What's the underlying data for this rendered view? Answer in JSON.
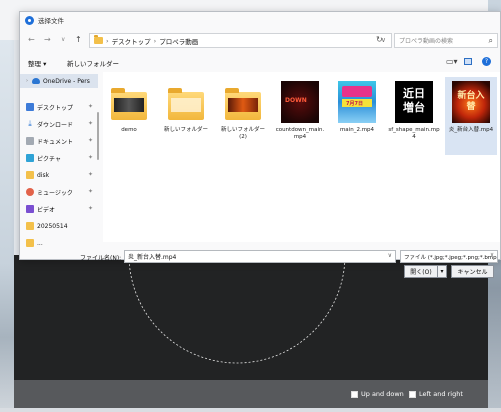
{
  "dialog": {
    "title": "选择文件",
    "nav": {
      "back": "←",
      "forward": "→",
      "recent": "∨",
      "up": "↑"
    },
    "address": {
      "parts": [
        "デスクトップ",
        "プロペラ動画"
      ],
      "sep": "›"
    },
    "search_placeholder": "プロペラ動画の検索",
    "toolbar": {
      "organize": "整理 ▾",
      "new_folder": "新しいフォルダー"
    },
    "sidebar": [
      {
        "label": "OneDrive - Pers",
        "icon": "cloud-icon"
      },
      {
        "label": "デスクトップ",
        "icon": "desktop-icon"
      },
      {
        "label": "ダウンロード",
        "icon": "download-icon"
      },
      {
        "label": "ドキュメント",
        "icon": "document-icon"
      },
      {
        "label": "ピクチャ",
        "icon": "pictures-icon"
      },
      {
        "label": "disk",
        "icon": "folder-icon"
      },
      {
        "label": "ミュージック",
        "icon": "music-icon"
      },
      {
        "label": "ビデオ",
        "icon": "video-icon"
      },
      {
        "label": "20250514",
        "icon": "folder-icon"
      },
      {
        "label": "...",
        "icon": "folder-icon"
      }
    ],
    "files": [
      {
        "name": "demo",
        "kind": "folder"
      },
      {
        "name": "新しいフォルダー",
        "kind": "folder"
      },
      {
        "name": "新しいフォルダー (2)",
        "kind": "folder"
      },
      {
        "name": "countdown_main.mp4",
        "kind": "video",
        "thumb_text": "DOWN"
      },
      {
        "name": "main_2.mp4",
        "kind": "video",
        "thumb_text": "7月7日"
      },
      {
        "name": "sf_shape_main.mp4",
        "kind": "video",
        "thumb_text": "近日増台"
      },
      {
        "name": "炎_新台入替.mp4",
        "kind": "video",
        "thumb_text": "新台入替"
      }
    ],
    "filename_label": "ファイル名(N):",
    "filename_value": "炎_新台入替.mp4",
    "filetype_value": "ファイル (*.jpg;*.jpeg;*.png;*.bmp",
    "open_label": "開く(O)",
    "cancel_label": "キャンセル"
  },
  "app": {
    "option_updown": "Up and down",
    "option_leftright": "Left and right"
  }
}
